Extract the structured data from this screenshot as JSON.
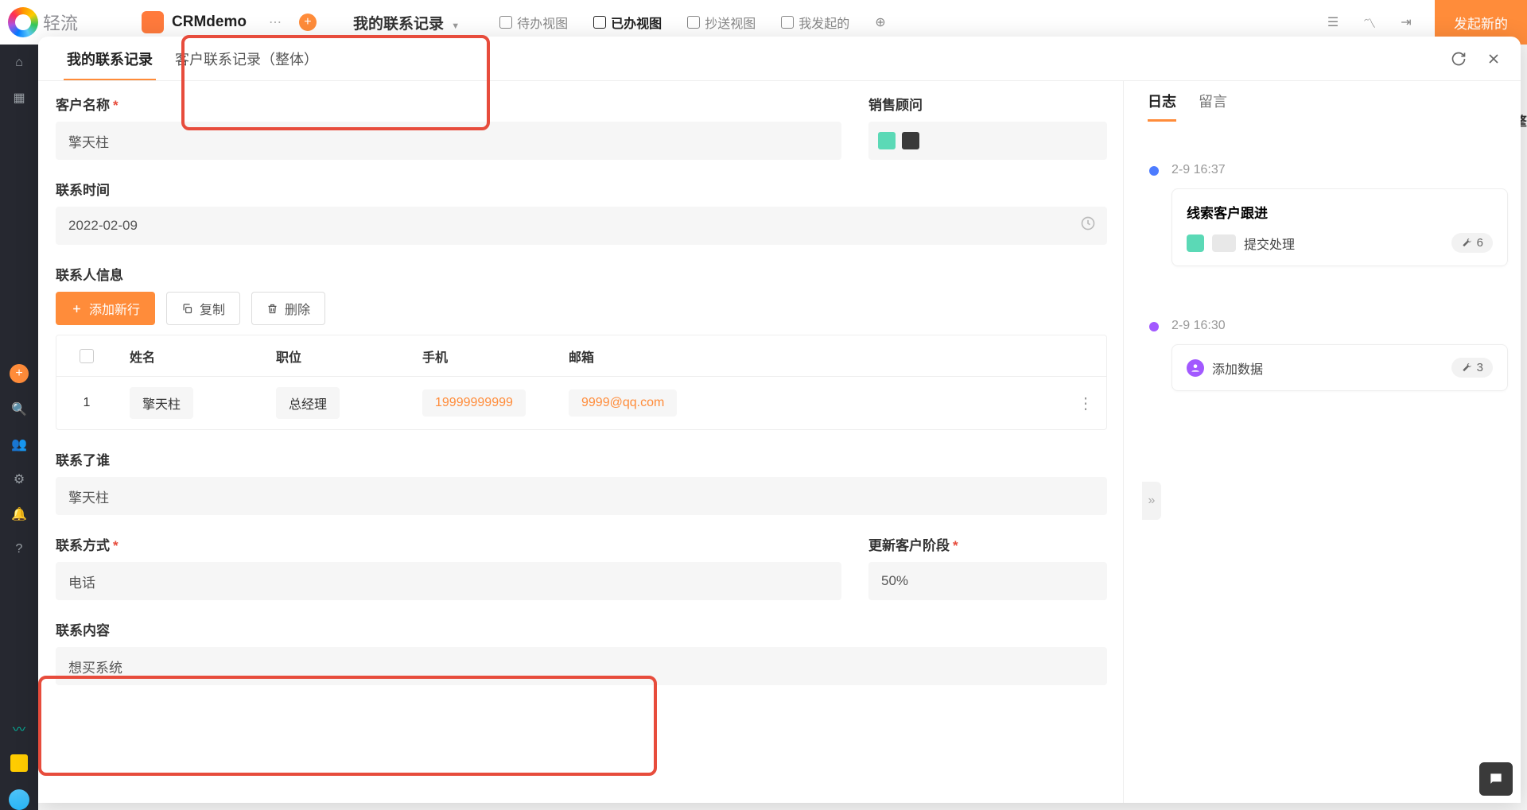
{
  "brand": "轻流",
  "app_name": "CRMdemo",
  "workspace": "我的联系记录",
  "top_views": [
    {
      "label": "待办视图",
      "active": false
    },
    {
      "label": "已办视图",
      "active": true
    },
    {
      "label": "抄送视图",
      "active": false
    },
    {
      "label": "我发起的",
      "active": false
    }
  ],
  "create_button": "发起新的",
  "modal_tabs": [
    {
      "label": "我的联系记录",
      "active": true
    },
    {
      "label": "客户联系记录（整体）",
      "active": false
    }
  ],
  "form": {
    "customer_name": {
      "label": "客户名称",
      "value": "擎天柱",
      "required": true
    },
    "sales_advisor": {
      "label": "销售顾问"
    },
    "contact_time": {
      "label": "联系时间",
      "value": "2022-02-09"
    },
    "contact_info": {
      "label": "联系人信息",
      "add_btn": "添加新行",
      "copy_btn": "复制",
      "delete_btn": "删除",
      "headers": {
        "name": "姓名",
        "position": "职位",
        "phone": "手机",
        "email": "邮箱"
      },
      "rows": [
        {
          "idx": "1",
          "name": "擎天柱",
          "position": "总经理",
          "phone": "19999999999",
          "email": "9999@qq.com"
        }
      ]
    },
    "contacted_who": {
      "label": "联系了谁",
      "value": "擎天柱"
    },
    "contact_method": {
      "label": "联系方式",
      "value": "电话",
      "required": true
    },
    "update_stage": {
      "label": "更新客户阶段",
      "value": "50%",
      "required": true
    },
    "contact_content": {
      "label": "联系内容",
      "value": "想买系统"
    }
  },
  "side_panel": {
    "tabs": [
      {
        "label": "日志",
        "active": true
      },
      {
        "label": "留言",
        "active": false
      }
    ],
    "timeline": [
      {
        "time": "2-9 16:37",
        "dot": "blue",
        "title": "线索客户跟进",
        "action": "提交处理",
        "avatar": "g",
        "badge": "6"
      },
      {
        "time": "2-9 16:30",
        "dot": "purple",
        "title": "",
        "action": "添加数据",
        "avatar": "p",
        "badge": "3"
      }
    ]
  },
  "bg_sliver": "擎"
}
